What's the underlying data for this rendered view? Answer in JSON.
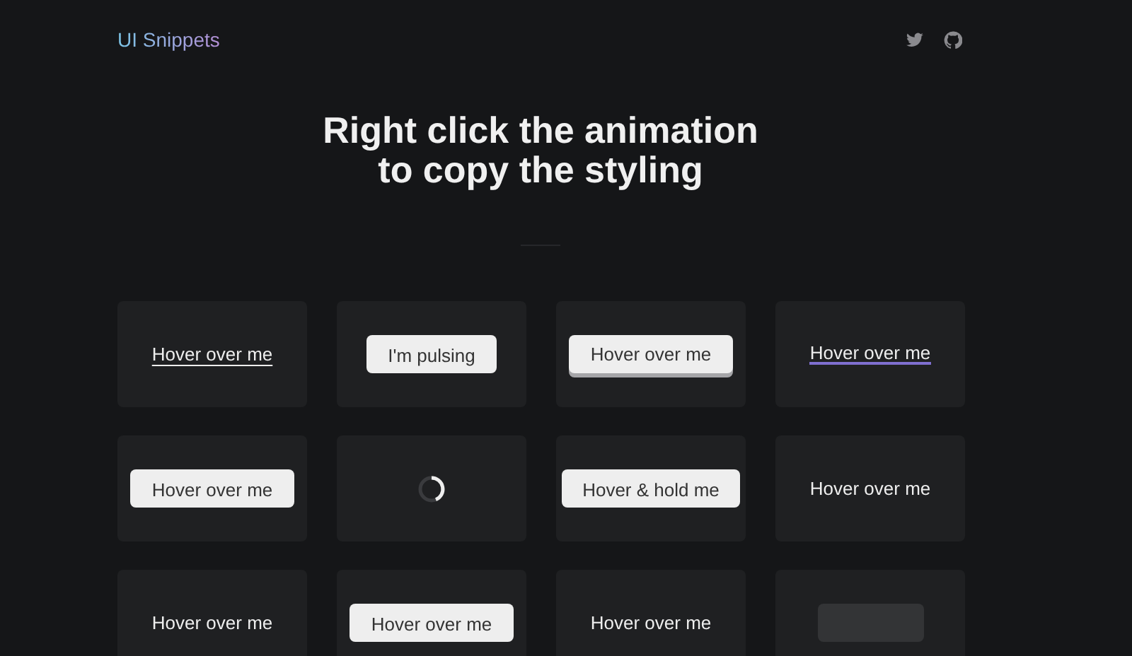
{
  "header": {
    "logo": "UI Snippets"
  },
  "headline": {
    "lines": [
      "Right click the animation",
      "to copy the styling"
    ]
  },
  "tiles": [
    {
      "kind": "link",
      "label": "Hover over me"
    },
    {
      "kind": "button",
      "label": "I'm pulsing"
    },
    {
      "kind": "raised",
      "label": "Hover over me"
    },
    {
      "kind": "gradient",
      "label": "Hover over me"
    },
    {
      "kind": "button",
      "label": "Hover over me"
    },
    {
      "kind": "spinner"
    },
    {
      "kind": "button",
      "label": "Hover & hold me"
    },
    {
      "kind": "text",
      "label": "Hover over me"
    },
    {
      "kind": "text",
      "label": "Hover over me"
    },
    {
      "kind": "button",
      "label": "Hover over me"
    },
    {
      "kind": "text",
      "label": "Hover over me"
    },
    {
      "kind": "blank"
    }
  ]
}
